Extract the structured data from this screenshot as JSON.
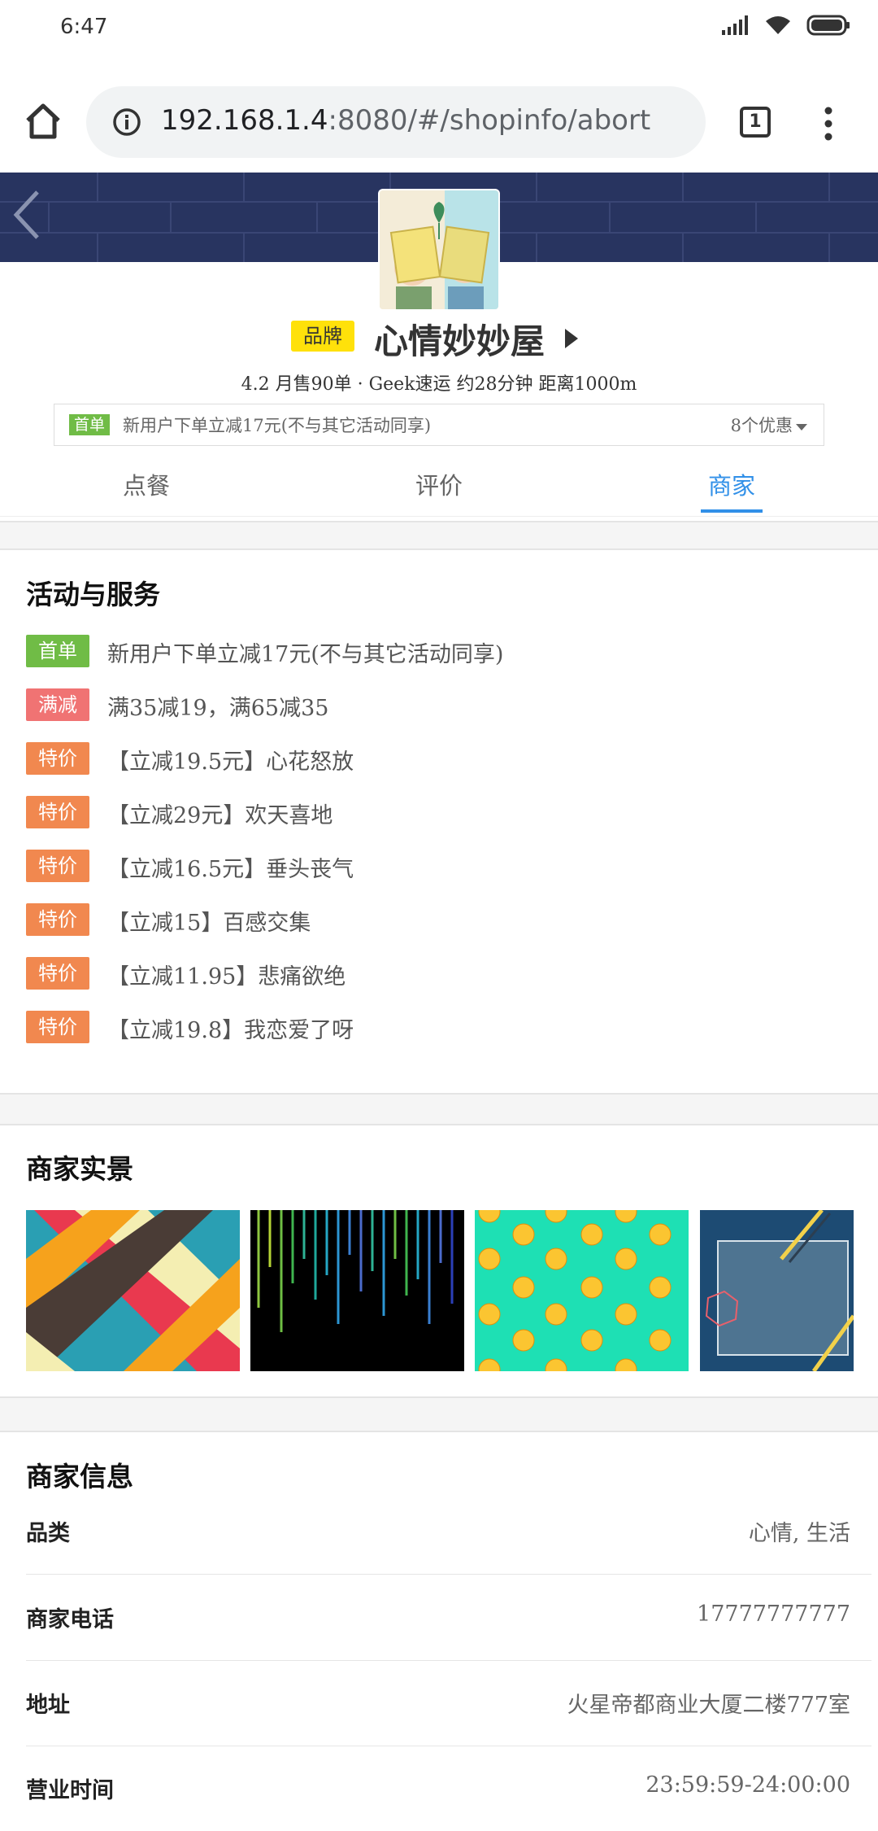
{
  "status_bar": {
    "time": "6:47"
  },
  "browser": {
    "url_host": "192.168.1.4",
    "url_path": ":8080/#/shopinfo/abort",
    "tab_count": "1"
  },
  "shop": {
    "brand_badge": "品牌",
    "name": "心情妙妙屋",
    "meta": "4.2  月售90单 · Geek速运 约28分钟  距离1000m",
    "promo_tag": "首单",
    "promo_text": "新用户下单立减17元(不与其它活动同享)",
    "promo_count": "8个优惠"
  },
  "tabs": [
    {
      "label": "点餐",
      "active": false
    },
    {
      "label": "评价",
      "active": false
    },
    {
      "label": "商家",
      "active": true
    }
  ],
  "activities": {
    "title": "活动与服务",
    "items": [
      {
        "tag": "首单",
        "text": "新用户下单立减17元(不与其它活动同享)",
        "color": "#70bc46"
      },
      {
        "tag": "满减",
        "text": "满35减19，满65减35",
        "color": "#f07373"
      },
      {
        "tag": "特价",
        "text": "【立减19.5元】心花怒放",
        "color": "#f1884f"
      },
      {
        "tag": "特价",
        "text": "【立减29元】欢天喜地",
        "color": "#f1884f"
      },
      {
        "tag": "特价",
        "text": "【立减16.5元】垂头丧气",
        "color": "#f1884f"
      },
      {
        "tag": "特价",
        "text": "【立减15】百感交集",
        "color": "#f1884f"
      },
      {
        "tag": "特价",
        "text": "【立减11.95】悲痛欲绝",
        "color": "#f1884f"
      },
      {
        "tag": "特价",
        "text": "【立减19.8】我恋爱了呀",
        "color": "#f1884f"
      }
    ]
  },
  "scenery": {
    "title": "商家实景"
  },
  "info": {
    "title": "商家信息",
    "rows": [
      {
        "label": "品类",
        "value": "心情, 生活"
      },
      {
        "label": "商家电话",
        "value": "17777777777"
      },
      {
        "label": "地址",
        "value": "火星帝都商业大厦二楼777室"
      },
      {
        "label": "营业时间",
        "value": "23:59:59-24:00:00"
      }
    ]
  },
  "colors": {
    "accent": "#3190e8",
    "header_bg": "#283460",
    "brand_yellow": "#ffe10a"
  }
}
